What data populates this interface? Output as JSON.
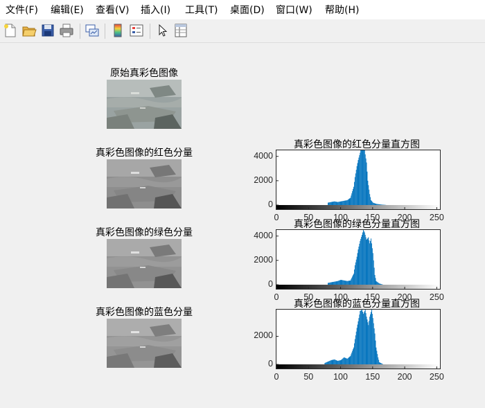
{
  "menu": [
    {
      "label": "文件(F)"
    },
    {
      "label": "编辑(E)"
    },
    {
      "label": "查看(V)"
    },
    {
      "label": "插入(I)"
    },
    {
      "label": "工具(T)"
    },
    {
      "label": "桌面(D)"
    },
    {
      "label": "窗口(W)"
    },
    {
      "label": "帮助(H)"
    }
  ],
  "toolbar": {
    "icons": [
      "new-figure-icon",
      "open-file-icon",
      "save-icon",
      "print-icon",
      "link-plot-icon",
      "insert-colorbar-icon",
      "insert-legend-icon",
      "edit-plot-pointer-icon",
      "property-inspector-icon"
    ]
  },
  "images": [
    {
      "title": "原始真彩色图像",
      "tint": "color"
    },
    {
      "title": "真彩色图像的红色分量",
      "tint": "gray"
    },
    {
      "title": "真彩色图像的绿色分量",
      "tint": "gray"
    },
    {
      "title": "真彩色图像的蓝色分量",
      "tint": "gray"
    }
  ],
  "colors": {
    "bar": "#0072bd",
    "axes": "#262626",
    "background": "#f0f0f0"
  },
  "chart_data": [
    {
      "type": "bar",
      "title": "真彩色图像的红色分量直方图",
      "xlim": [
        0,
        255
      ],
      "ylim": [
        0,
        4500
      ],
      "xticks": [
        0,
        50,
        100,
        150,
        200,
        250
      ],
      "yticks": [
        0,
        2000,
        4000
      ],
      "x": [
        80,
        85,
        90,
        95,
        100,
        105,
        110,
        115,
        120,
        122,
        125,
        127,
        130,
        132,
        135,
        137,
        140,
        142,
        145,
        147,
        150,
        155,
        160,
        165,
        170
      ],
      "values": [
        200,
        250,
        300,
        250,
        300,
        350,
        400,
        600,
        1500,
        2300,
        3200,
        3700,
        4300,
        4700,
        4600,
        4500,
        3500,
        2000,
        900,
        400,
        200,
        100,
        60,
        30,
        10
      ]
    },
    {
      "type": "bar",
      "title": "真彩色图像的绿色分量直方图",
      "xlim": [
        0,
        255
      ],
      "ylim": [
        0,
        4500
      ],
      "xticks": [
        0,
        50,
        100,
        150,
        200,
        250
      ],
      "yticks": [
        0,
        2000,
        4000
      ],
      "x": [
        80,
        85,
        90,
        95,
        100,
        105,
        110,
        115,
        120,
        122,
        125,
        127,
        130,
        133,
        135,
        137,
        140,
        143,
        145,
        147,
        150,
        153,
        155,
        160,
        165
      ],
      "values": [
        150,
        200,
        250,
        300,
        400,
        350,
        300,
        350,
        900,
        1600,
        2300,
        2900,
        3600,
        4100,
        4500,
        4300,
        3700,
        3900,
        3400,
        3800,
        2600,
        800,
        300,
        100,
        20
      ]
    },
    {
      "type": "bar",
      "title": "真彩色图像的蓝色分量直方图",
      "xlim": [
        0,
        255
      ],
      "ylim": [
        0,
        3900
      ],
      "xticks": [
        0,
        50,
        100,
        150,
        200,
        250
      ],
      "yticks": [
        0,
        2000
      ],
      "x": [
        75,
        80,
        85,
        90,
        95,
        100,
        105,
        110,
        115,
        120,
        122,
        125,
        128,
        130,
        133,
        135,
        138,
        140,
        143,
        145,
        148,
        150,
        153,
        155,
        158,
        160,
        165
      ],
      "values": [
        100,
        200,
        300,
        350,
        250,
        300,
        500,
        400,
        600,
        1200,
        1800,
        2600,
        3300,
        3800,
        3900,
        3600,
        3900,
        3400,
        2800,
        3400,
        3900,
        3300,
        2200,
        1200,
        500,
        150,
        30
      ]
    }
  ]
}
